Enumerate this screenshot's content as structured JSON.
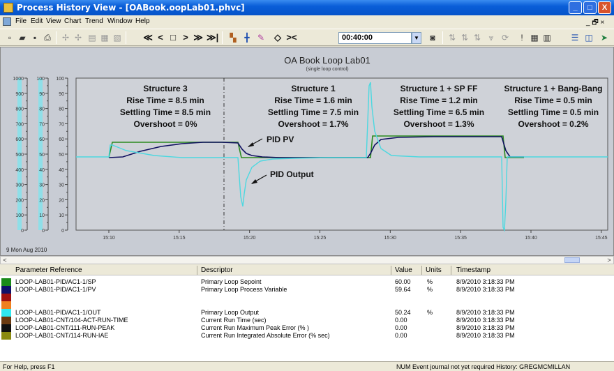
{
  "window": {
    "title": "Process History View - [OABook.oopLab01.phvc]",
    "min_glyph": "_",
    "max_glyph": "□",
    "close_glyph": "X"
  },
  "menu": [
    "File",
    "Edit",
    "View",
    "Chart",
    "Trend",
    "Window",
    "Help"
  ],
  "mdi_controls": "_ 🗗 ×",
  "toolbar": {
    "time_value": "00:40:00",
    "nav_glyphs": [
      "≪",
      "<",
      "□",
      ">",
      "≫",
      "≫|"
    ]
  },
  "chart": {
    "title": "OA Book Loop Lab01",
    "subtitle": "(single loop control)",
    "date_label": "9 Mon Aug 2010",
    "y_axis1": [
      "1000",
      "900",
      "800",
      "700",
      "600",
      "500",
      "400",
      "300",
      "200",
      "100",
      "0"
    ],
    "y_axis2": [
      "100",
      "90",
      "80",
      "70",
      "60",
      "50",
      "40",
      "30",
      "20",
      "10",
      "0"
    ],
    "y_axis3": [
      "100",
      "90",
      "80",
      "70",
      "60",
      "50",
      "40",
      "30",
      "20",
      "10",
      "0"
    ],
    "x_ticks": [
      "15:10",
      "15:15",
      "15:20",
      "15:25",
      "15:30",
      "15:35",
      "15:40",
      "15:45"
    ],
    "annotations": [
      {
        "lines": [
          "Structure 3",
          "Rise Time = 8.5 min",
          "Settling Time = 8.5 min",
          "Overshoot = 0%"
        ]
      },
      {
        "lines": [
          "Structure 1",
          "Rise Time = 1.6 min",
          "Settling Time = 7.5 min",
          "Overshoot = 1.7%"
        ]
      },
      {
        "lines": [
          "Structure 1 + SP FF",
          "Rise Time = 1.2 min",
          "Settling Time = 6.5 min",
          "Overshoot = 1.3%"
        ]
      },
      {
        "lines": [
          "Structure 1 + Bang-Bang",
          "Rise Time = 0.5 min",
          "Settling Time = 0.5 min",
          "Overshoot = 0.2%"
        ]
      }
    ],
    "pid_pv_label": "PID PV",
    "pid_output_label": "PID Output",
    "colors": {
      "sp": "#2a8a1e",
      "pv": "#101060",
      "out": "#4cd8e0",
      "bg": "#c8ccd4"
    }
  },
  "table": {
    "headers": {
      "param": "Parameter Reference",
      "desc": "Descriptor",
      "value": "Value",
      "units": "Units",
      "time": "Timestamp"
    },
    "rows": [
      {
        "color": "#1a8a1a",
        "param": "LOOP-LAB01-PID/AC1-1/SP",
        "desc": "Primary Loop Sepoint",
        "value": "60.00",
        "units": "%",
        "time": "8/9/2010 3:18:33 PM"
      },
      {
        "color": "#10106a",
        "param": "LOOP-LAB01-PID/AC1-1/PV",
        "desc": "Primary Loop Process Variable",
        "value": "59.64",
        "units": "%",
        "time": "8/9/2010 3:18:33 PM"
      },
      {
        "color": "#a01010",
        "param": "",
        "desc": "",
        "value": "",
        "units": "",
        "time": ""
      },
      {
        "color": "#f08020",
        "param": "",
        "desc": "",
        "value": "",
        "units": "",
        "time": ""
      },
      {
        "color": "#30e8f0",
        "param": "LOOP-LAB01-PID/AC1-1/OUT",
        "desc": "Primary Loop Output",
        "value": "50.24",
        "units": "%",
        "time": "8/9/2010 3:18:33 PM"
      },
      {
        "color": "#6a3a10",
        "param": "LOOP-LAB01-CNT/104-ACT-RUN-TIME",
        "desc": "Current Run Time (sec)",
        "value": "0.00",
        "units": "",
        "time": "8/9/2010 3:18:33 PM"
      },
      {
        "color": "#101010",
        "param": "LOOP-LAB01-CNT/111-RUN-PEAK",
        "desc": "Current Run Maximum Peak Error (% )",
        "value": "0.00",
        "units": "",
        "time": "8/9/2010 3:18:33 PM"
      },
      {
        "color": "#8a8a10",
        "param": "LOOP-LAB01-CNT/114-RUN-IAE",
        "desc": "Current Run Integrated Absolute Error (% sec)",
        "value": "0.00",
        "units": "",
        "time": "8/9/2010 3:18:33 PM"
      }
    ]
  },
  "status": {
    "help": "For Help, press F1",
    "right": "NUM  Event journal not yet required  History: GREGMCMILLAN"
  }
}
